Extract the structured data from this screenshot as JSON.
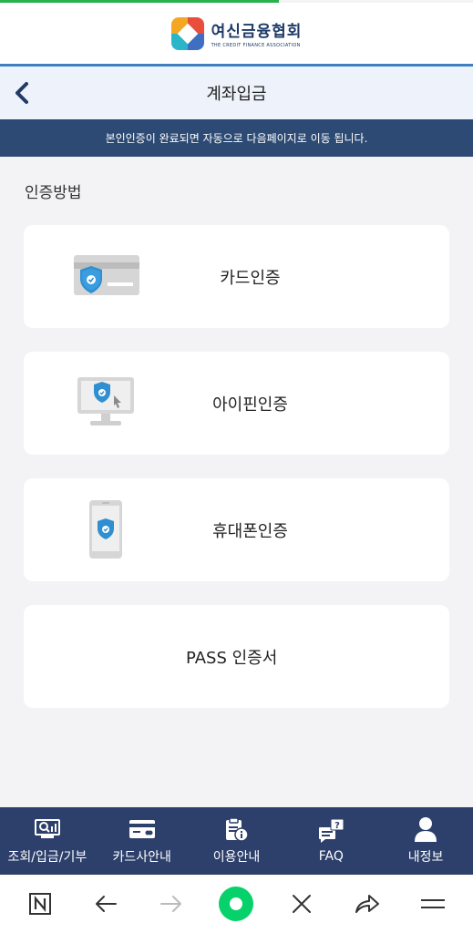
{
  "progress": {
    "percent": 59,
    "color": "#28b14c"
  },
  "brand": {
    "name": "여신금융협회",
    "sub": "THE CREDIT FINANCE ASSOCIATION"
  },
  "header": {
    "title": "계좌입금",
    "back_icon": "chevron-left-icon"
  },
  "notice": "본인인증이 완료되면 자동으로 다음페이지로 이동 됩니다.",
  "section_label": "인증방법",
  "methods": [
    {
      "label": "카드인증",
      "icon": "card-shield-icon"
    },
    {
      "label": "아이핀인증",
      "icon": "monitor-shield-icon"
    },
    {
      "label": "휴대폰인증",
      "icon": "phone-shield-icon"
    },
    {
      "label": "PASS 인증서",
      "icon": ""
    }
  ],
  "tabs": [
    {
      "label": "조회/입금/기부",
      "icon": "search-chart-icon"
    },
    {
      "label": "카드사안내",
      "icon": "credit-card-icon"
    },
    {
      "label": "이용안내",
      "icon": "clipboard-info-icon"
    },
    {
      "label": "FAQ",
      "icon": "chat-question-icon"
    },
    {
      "label": "내정보",
      "icon": "user-icon"
    }
  ],
  "browser_nav": [
    "naver-home-icon",
    "back-arrow-icon",
    "forward-arrow-icon",
    "green-dot-icon",
    "close-icon",
    "share-icon",
    "menu-icon"
  ],
  "colors": {
    "navy": "#2d3f6b",
    "notice_bg": "#2c4a73",
    "accent": "#3f7fbf",
    "brand": "#1e3a67"
  }
}
